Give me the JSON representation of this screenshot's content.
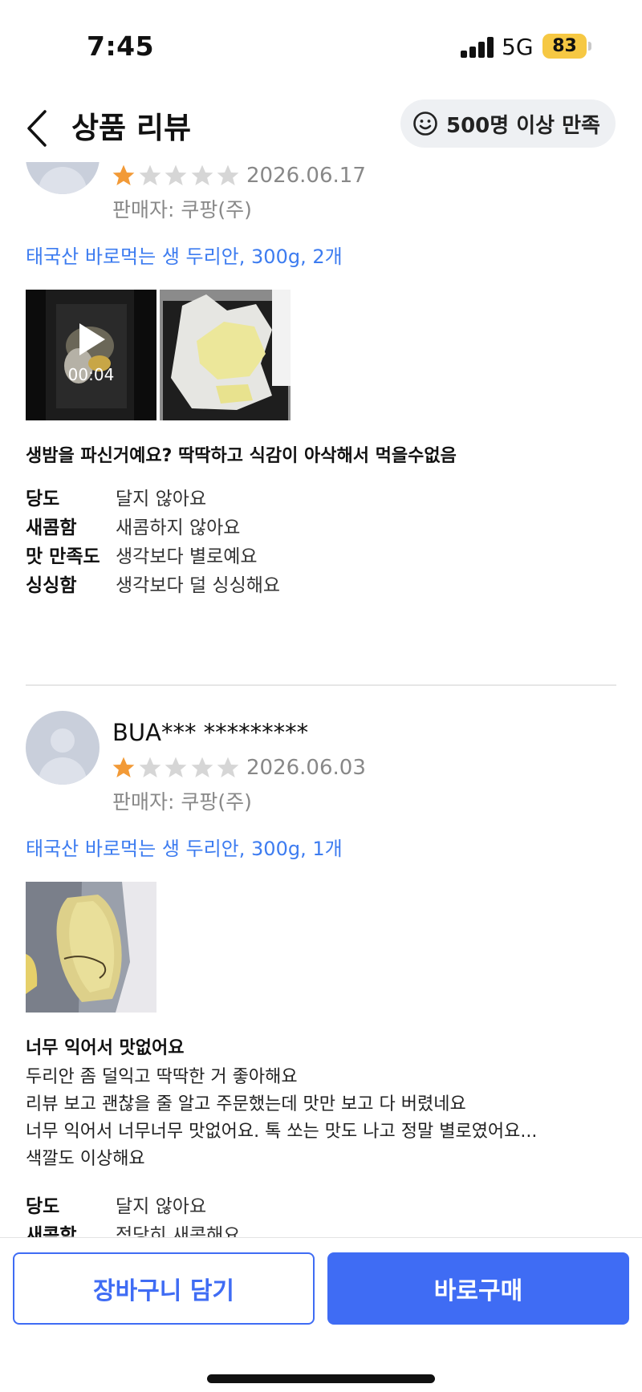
{
  "status_bar": {
    "time": "7:45",
    "network": "5G",
    "battery": "83"
  },
  "header": {
    "title": "상품 리뷰",
    "badge_label": "500명 이상 만족",
    "back_icon": "chevron-left-icon",
    "badge_icon": "smiley-icon"
  },
  "colors": {
    "accent": "#3f6cf4",
    "link": "#3d7cf0",
    "star_filled": "#f29a37",
    "star_empty": "#d6d6d6",
    "badge_bg": "#eef0f3",
    "battery": "#f6c843"
  },
  "reviews": [
    {
      "reviewer": "",
      "rating": 1,
      "max_rating": 5,
      "date": "2026.06.17",
      "seller": "판매자: 쿠팡(주)",
      "option": "태국산 바로먹는 생 두리안, 300g, 2개",
      "media": [
        {
          "type": "video",
          "duration": "00:04"
        },
        {
          "type": "photo"
        }
      ],
      "headline": "생밤을 파신거예요? 딱딱하고 식감이 아삭해서 먹을수없음",
      "body": [],
      "attributes": [
        {
          "label": "당도",
          "value": "달지 않아요"
        },
        {
          "label": "새콤함",
          "value": "새콤하지 않아요"
        },
        {
          "label": "맛 만족도",
          "value": "생각보다 별로예요"
        },
        {
          "label": "싱싱함",
          "value": "생각보다 덜 싱싱해요"
        }
      ]
    },
    {
      "reviewer": "BUA*** *********",
      "rating": 1,
      "max_rating": 5,
      "date": "2026.06.03",
      "seller": "판매자: 쿠팡(주)",
      "option": "태국산 바로먹는 생 두리안, 300g, 1개",
      "media": [
        {
          "type": "photo"
        }
      ],
      "headline": "너무 익어서 맛없어요",
      "body": [
        "두리안 좀 덜익고 딱딱한 거 좋아해요",
        "리뷰 보고 괜찮을 줄 알고 주문했는데 맛만 보고 다 버렸네요",
        "너무 익어서 너무너무 맛없어요. 톡 쏘는 맛도 나고 정말 별로였어요...",
        "색깔도 이상해요"
      ],
      "attributes": [
        {
          "label": "당도",
          "value": "달지 않아요"
        },
        {
          "label": "새콤함",
          "value": "적당히 새콤해요"
        }
      ]
    }
  ],
  "bottom_bar": {
    "cart_label": "장바구니 담기",
    "buy_label": "바로구매"
  }
}
